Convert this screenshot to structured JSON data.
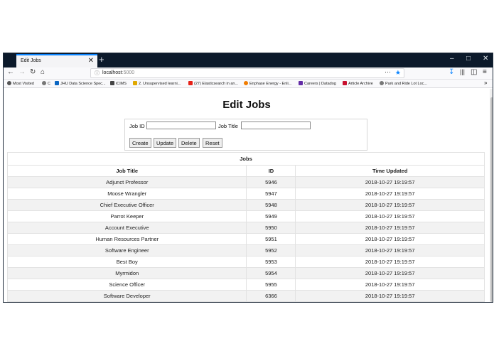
{
  "browser": {
    "tab_title": "Edit Jobs",
    "tab_close": "✕",
    "new_tab": "+",
    "url_host": "localhost",
    "url_port": ":5000",
    "bookmarks": [
      {
        "label": "Most Visited",
        "icon": "gear-icon",
        "color": "#555555"
      },
      {
        "label": "C",
        "icon": "globe-icon",
        "color": "#555555"
      },
      {
        "label": "JHU Data Science Spec...",
        "icon": "linkedin-icon",
        "color": "#0a66c2"
      },
      {
        "label": "iCIMS",
        "icon": "phone-icon",
        "color": "#333333"
      },
      {
        "label": "2. Unsupervised learni...",
        "icon": "chart-icon",
        "color": "#e0a800"
      },
      {
        "label": "(27) Elasticsearch in an...",
        "icon": "youtube-icon",
        "color": "#e62117"
      },
      {
        "label": "Enphase Energy - Enli...",
        "icon": "enphase-icon",
        "color": "#f07c00"
      },
      {
        "label": "Careers | Datadog",
        "icon": "datadog-icon",
        "color": "#632ca6"
      },
      {
        "label": "Article Archive",
        "icon": "archive-icon",
        "color": "#c8102e"
      },
      {
        "label": "Park and Ride Lot Loc...",
        "icon": "globe-icon",
        "color": "#555555"
      }
    ]
  },
  "page": {
    "title": "Edit Jobs",
    "form": {
      "job_id_label": "Job ID",
      "job_id_value": "",
      "job_title_label": "Job Title",
      "job_title_value": "",
      "buttons": [
        "Create",
        "Update",
        "Delete",
        "Reset"
      ]
    },
    "table": {
      "caption": "Jobs",
      "columns": [
        "Job Title",
        "ID",
        "Time Updated"
      ],
      "rows": [
        [
          "Adjunct Professor",
          "5946",
          "2018-10-27 19:19:57"
        ],
        [
          "Moose Wrangler",
          "5947",
          "2018-10-27 19:19:57"
        ],
        [
          "Chief Executive Officer",
          "5948",
          "2018-10-27 19:19:57"
        ],
        [
          "Parrot Keeper",
          "5949",
          "2018-10-27 19:19:57"
        ],
        [
          "Account Executive",
          "5950",
          "2018-10-27 19:19:57"
        ],
        [
          "Human Resources Partner",
          "5951",
          "2018-10-27 19:19:57"
        ],
        [
          "Software Engineer",
          "5952",
          "2018-10-27 19:19:57"
        ],
        [
          "Best Boy",
          "5953",
          "2018-10-27 19:19:57"
        ],
        [
          "Myrmidon",
          "5954",
          "2018-10-27 19:19:57"
        ],
        [
          "Science Officer",
          "5955",
          "2018-10-27 19:19:57"
        ],
        [
          "Software Developer",
          "6366",
          "2018-10-27 19:19:57"
        ]
      ]
    }
  }
}
